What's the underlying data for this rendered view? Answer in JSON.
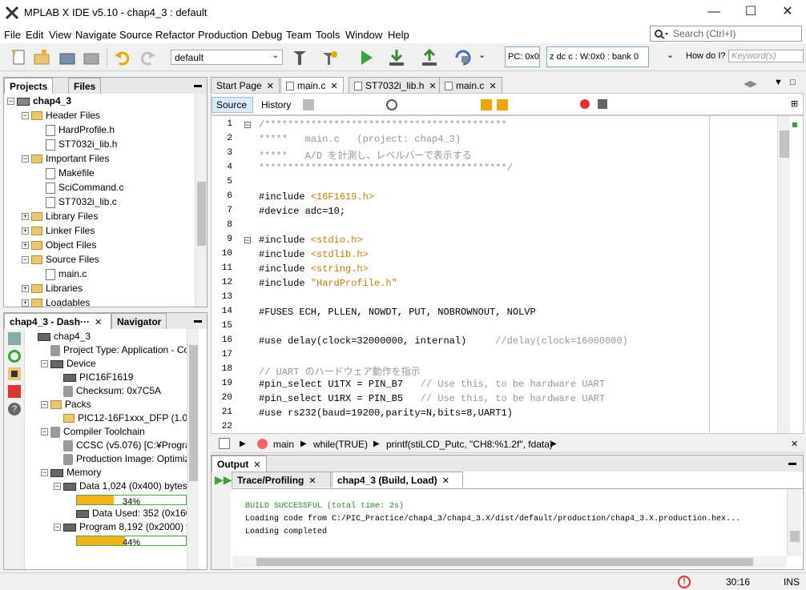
{
  "window": {
    "title": "MPLAB X IDE v5.10 - chap4_3 : default"
  },
  "menu": [
    "File",
    "Edit",
    "View",
    "Navigate",
    "Source",
    "Refactor",
    "Production",
    "Debug",
    "Team",
    "Tools",
    "Window",
    "Help"
  ],
  "search": {
    "placeholder": "Search (Ctrl+I)"
  },
  "toolbar": {
    "config": "default",
    "pc": "PC: 0x0",
    "status": "z dc c  : W:0x0 : bank 0",
    "howdo": "How do I?",
    "keyword": "Keyword(s)"
  },
  "projects": {
    "tabs": [
      "Projects",
      "Files"
    ],
    "root": "chap4_3",
    "items": [
      {
        "label": "Header Files",
        "type": "folder",
        "level": 1,
        "expanded": true
      },
      {
        "label": "HardProfile.h",
        "type": "file",
        "level": 2
      },
      {
        "label": "ST7032i_lib.h",
        "type": "file",
        "level": 2
      },
      {
        "label": "Important Files",
        "type": "folder",
        "level": 1,
        "expanded": true
      },
      {
        "label": "Makefile",
        "type": "file",
        "level": 2
      },
      {
        "label": "SciCommand.c",
        "type": "file",
        "level": 2
      },
      {
        "label": "ST7032i_lib.c",
        "type": "file",
        "level": 2
      },
      {
        "label": "Library Files",
        "type": "folder",
        "level": 1,
        "expanded": false
      },
      {
        "label": "Linker Files",
        "type": "folder",
        "level": 1,
        "expanded": false
      },
      {
        "label": "Object Files",
        "type": "folder",
        "level": 1,
        "expanded": false
      },
      {
        "label": "Source Files",
        "type": "folder",
        "level": 1,
        "expanded": true
      },
      {
        "label": "main.c",
        "type": "file",
        "level": 2
      },
      {
        "label": "Libraries",
        "type": "folder",
        "level": 1,
        "expanded": false
      },
      {
        "label": "Loadables",
        "type": "folder",
        "level": 1,
        "expanded": false
      }
    ]
  },
  "dashboard": {
    "tabs": [
      "chap4_3 - Dash···",
      "Navigator"
    ],
    "items": [
      {
        "label": "chap4_3",
        "level": 0
      },
      {
        "label": "Project Type: Application - Co",
        "level": 1
      },
      {
        "label": "Device",
        "level": 1
      },
      {
        "label": "PIC16F1619",
        "level": 2
      },
      {
        "label": "Checksum: 0x7C5A",
        "level": 2
      },
      {
        "label": "Packs",
        "level": 1
      },
      {
        "label": "PIC12-16F1xxx_DFP (1.0.2",
        "level": 2
      },
      {
        "label": "Compiler Toolchain",
        "level": 1
      },
      {
        "label": "CCSC (v5.076) [C:¥Program",
        "level": 2
      },
      {
        "label": "Production Image: Optimiza",
        "level": 2
      },
      {
        "label": "Memory",
        "level": 1
      },
      {
        "label": "Data 1,024 (0x400) bytes",
        "level": 2
      },
      {
        "label": "Data Used: 352 (0x160)",
        "level": 3
      },
      {
        "label": "Program 8,192 (0x2000) wo",
        "level": 2
      }
    ],
    "data_pct": "34%",
    "data_frac": 0.34,
    "prog_pct": "44%",
    "prog_frac": 0.44
  },
  "editor": {
    "tabs": [
      "Start Page",
      "main.c",
      "ST7032i_lib.h",
      "main.c"
    ],
    "subtabs": [
      "Source",
      "History"
    ],
    "lines": [
      {
        "n": "1",
        "t": "/******************************************",
        "c": "cmt"
      },
      {
        "n": "2",
        "t": "*****   main.c   (project: chap4_3)",
        "c": "cmt"
      },
      {
        "n": "3",
        "t": "*****   A/D を計測し、レベルバーで表示する",
        "c": "cmt"
      },
      {
        "n": "4",
        "t": "*******************************************/",
        "c": "cmt"
      },
      {
        "n": "5",
        "t": "",
        "c": ""
      },
      {
        "n": "6",
        "t": "#include ",
        "s": "<16F1619.h>",
        "c": "dir"
      },
      {
        "n": "7",
        "t": "#device adc=10;",
        "c": "dir"
      },
      {
        "n": "8",
        "t": "",
        "c": ""
      },
      {
        "n": "9",
        "t": "#include ",
        "s": "<stdio.h>",
        "c": "dir"
      },
      {
        "n": "10",
        "t": "#include ",
        "s": "<stdlib.h>",
        "c": "dir"
      },
      {
        "n": "11",
        "t": "#include ",
        "s": "<string.h>",
        "c": "dir"
      },
      {
        "n": "12",
        "t": "#include ",
        "s": "\"HardProfile.h\"",
        "c": "dir"
      },
      {
        "n": "13",
        "t": "",
        "c": ""
      },
      {
        "n": "14",
        "t": "#FUSES ECH, PLLEN, NOWDT, PUT, NOBROWNOUT, NOLVP",
        "c": "dir"
      },
      {
        "n": "15",
        "t": "",
        "c": ""
      },
      {
        "n": "16",
        "t": "#use delay(clock=32000000, internal)     ",
        "cm": "//delay(clock=16000000)",
        "c": "dir"
      },
      {
        "n": "17",
        "t": "",
        "c": ""
      },
      {
        "n": "18",
        "t": "// UART のハードウェア動作を指示",
        "c": "cmt"
      },
      {
        "n": "19",
        "t": "#pin_select U1TX = PIN_B7   ",
        "cm": "// Use this, to be hardware UART",
        "c": "dir"
      },
      {
        "n": "20",
        "t": "#pin_select U1RX = PIN_B5   ",
        "cm": "// Use this, to be hardware UART",
        "c": "dir"
      },
      {
        "n": "21",
        "t": "#use rs232(baud=19200,parity=N,bits=8,UART1)",
        "c": "dir"
      },
      {
        "n": "22",
        "t": "",
        "c": ""
      }
    ],
    "breadcrumb": [
      "main",
      "while(TRUE)",
      "printf(stiLCD_Putc, \"CH8:%1.2f\", fdata)"
    ]
  },
  "output": {
    "title": "Output",
    "tabs": [
      "Trace/Profiling",
      "chap4_3 (Build, Load)"
    ],
    "lines": [
      {
        "t": "BUILD SUCCESSFUL (total time: 2s)",
        "c": "#228b22"
      },
      {
        "t": "Loading code from C:/PIC_Practice/chap4_3/chap4_3.X/dist/default/production/chap4_3.X.production.hex...",
        "c": "#000"
      },
      {
        "t": "Loading completed",
        "c": "#000"
      }
    ]
  },
  "statusbar": {
    "position": "30:16",
    "mode": "INS"
  }
}
